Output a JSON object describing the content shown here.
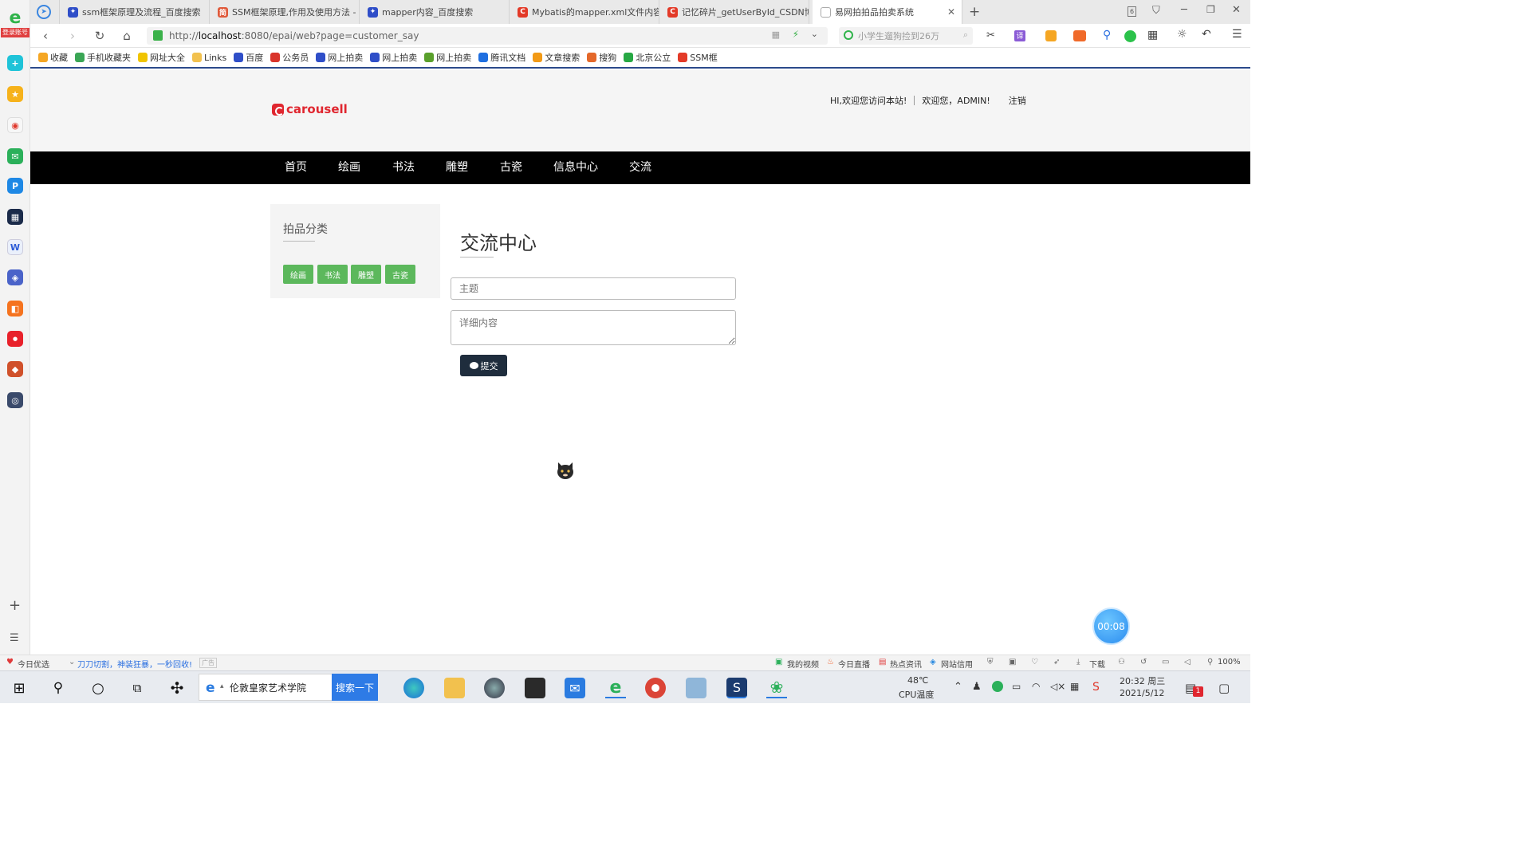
{
  "browser": {
    "sidebar_badge": "登录账号",
    "tabs": [
      {
        "title": "ssm框架原理及流程_百度搜索",
        "favicon": "baidu-paw-icon",
        "color": "#2f4ec8"
      },
      {
        "title": "SSM框架原理,作用及使用方法 -",
        "favicon": "jianshu-icon",
        "color": "#e05a3b"
      },
      {
        "title": "mapper内容_百度搜索",
        "favicon": "baidu-paw-icon",
        "color": "#2f4ec8"
      },
      {
        "title": "Mybatis的mapper.xml文件内容",
        "favicon": "csdn-icon",
        "color": "#e33a28"
      },
      {
        "title": "记忆碎片_getUserById_CSDN博",
        "favicon": "csdn-icon",
        "color": "#e33a28"
      },
      {
        "title": "易网拍拍品拍卖系统",
        "favicon": "page-icon",
        "color": "#9a9a9a"
      }
    ],
    "tab_count": "6",
    "url_prefix": "http://",
    "url_host": "localhost",
    "url_rest": ":8080/epai/web?page=customer_say",
    "search_placeholder": "小学生遛狗捡到26万",
    "bookmarks": [
      {
        "label": "收藏",
        "color": "#f5a623"
      },
      {
        "label": "手机收藏夹",
        "color": "#3aa655"
      },
      {
        "label": "网址大全",
        "color": "#f0c400"
      },
      {
        "label": "Links",
        "color": "#f2c14e"
      },
      {
        "label": "百度",
        "color": "#2f4ec8"
      },
      {
        "label": "公务员",
        "color": "#d9342b"
      },
      {
        "label": "网上拍卖",
        "color": "#2f4ec8"
      },
      {
        "label": "网上拍卖",
        "color": "#2f4ec8"
      },
      {
        "label": "网上拍卖",
        "color": "#5aa02c"
      },
      {
        "label": "腾讯文档",
        "color": "#1f6fe0"
      },
      {
        "label": "文章搜索",
        "color": "#f29a16"
      },
      {
        "label": "搜狗",
        "color": "#e4682a"
      },
      {
        "label": "北京公立",
        "color": "#27a844"
      },
      {
        "label": "SSM框",
        "color": "#e33a28"
      }
    ]
  },
  "site": {
    "logo_text": "carousell",
    "greeting": "HI,欢迎您访问本站!",
    "welcome_user": "欢迎您，ADMIN!",
    "logout": "注销",
    "nav": [
      "首页",
      "绘画",
      "书法",
      "雕塑",
      "古瓷",
      "信息中心",
      "交流"
    ],
    "category": {
      "title": "拍品分类",
      "items": [
        "绘画",
        "书法",
        "雕塑",
        "古瓷"
      ]
    },
    "form": {
      "title": "交流中心",
      "subject_placeholder": "主题",
      "detail_placeholder": "详细内容",
      "submit_label": "提交"
    },
    "timer": "00:08"
  },
  "statusbar": {
    "left1": "今日优选",
    "left2": "刀刀切割，神装狂暴，一秒回收!",
    "left2_tag": "广告",
    "right": [
      "我的视频",
      "今日直播",
      "热点资讯",
      "网站信用"
    ],
    "download": "下载",
    "zoom": "100%"
  },
  "taskbar": {
    "search_text": "伦敦皇家艺术学院",
    "search_button": "搜索一下",
    "temp": "48℃",
    "temp_label": "CPU温度",
    "time": "20:32 周三",
    "date": "2021/5/12",
    "notification_count": "1"
  }
}
